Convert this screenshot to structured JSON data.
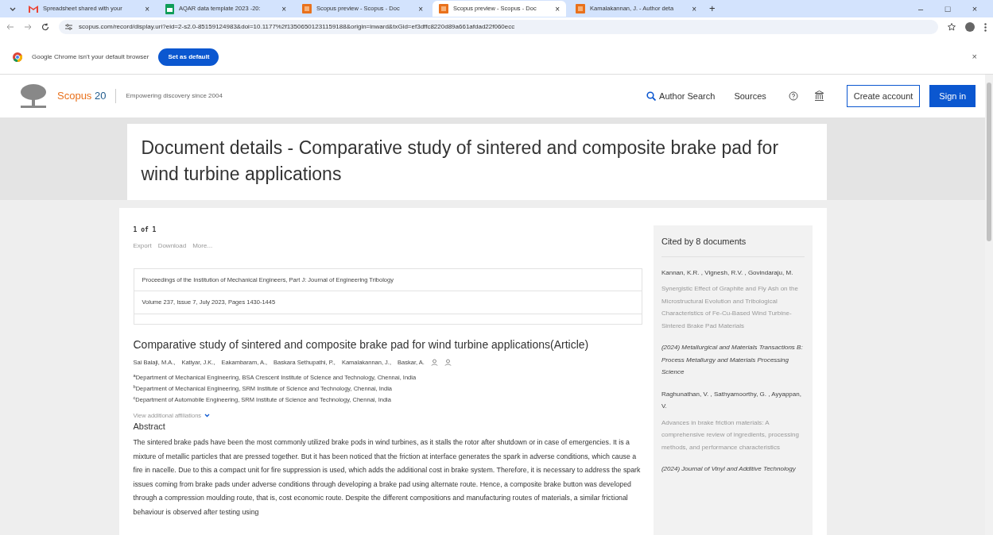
{
  "browser": {
    "tabs": [
      {
        "title": "Spreadsheet shared with your",
        "close": "×",
        "kind": "mail",
        "selected": false
      },
      {
        "title": "AQAR data template 2023 -20:",
        "close": "×",
        "kind": "sheet",
        "selected": false
      },
      {
        "title": "Scopus preview - Scopus - Doc",
        "close": "×",
        "kind": "scopus",
        "selected": false
      },
      {
        "title": "Scopus preview - Scopus - Doc",
        "close": "×",
        "kind": "scopus",
        "selected": true
      },
      {
        "title": "Kamalakannan, J. - Author deta",
        "close": "×",
        "kind": "scopus",
        "selected": false
      }
    ],
    "new_tab": "+",
    "window_controls": [
      "–",
      "□",
      "×"
    ],
    "url": "scopus.com/record/display.uri?eid=2-s2.0-85159124983&doi=10.1177%2f13506501231159188&origin=inward&txGid=ef3dffc8220d89a661afdad22f060ecc",
    "infobar": {
      "text": "Google Chrome isn't your default browser",
      "button": "Set as default",
      "close": "×"
    }
  },
  "header": {
    "brand": "Scopus",
    "anniversary": "20",
    "tagline": "Empowering discovery since 2004",
    "nav": [
      "Author Search",
      "Sources"
    ],
    "create_account": "Create account",
    "sign_in": "Sign in"
  },
  "page_title": "Document details - Comparative study of sintered and composite brake pad for wind turbine applications",
  "document": {
    "counter": "1 of 1",
    "actions": [
      "Export",
      "Download",
      "More..."
    ],
    "source": "Proceedings of the Institution of Mechanical Engineers, Part J: Journal of Engineering Tribology",
    "volume": "Volume 237, Issue 7, July 2023, Pages 1430-1445",
    "title": "Comparative study of sintered and composite brake pad for wind turbine applications(Article)",
    "authors": [
      "Sai Balaji, M.A.,",
      "Katiyar, J.K.,",
      "Eakambaram, A.,",
      "Baskara Sethupathi, P.,",
      "Kamalakannan, J.,",
      "Baskar, A."
    ],
    "affiliations": [
      "$^{a}$Department of Mechanical Engineering, BSA Crescent Institute of Science and Technology, Chennai, India",
      "$^{b}$Department of Mechanical Engineering, SRM Institute of Science and Technology, Chennai, India",
      "$^{c}$Department of Automobile Engineering, SRM Institute of Science and Technology, Chennai, India"
    ],
    "more_affiliations": "View additional affiliations",
    "abstract_heading": "Abstract",
    "abstract": "The sintered brake pads have been the most commonly utilized brake pods in wind turbines, as it stalls the rotor after shutdown or in case of emergencies. It is a mixture of metallic particles that are pressed together. But it has been noticed that the friction at interface generates the spark in adverse conditions, which cause a fire in nacelle. Due to this a compact unit for fire suppression is used, which adds the additional cost in brake system. Therefore, it is necessary to address the spark issues coming from brake pads under adverse conditions through developing a brake pad using alternate route. Hence, a composite brake button was developed through a compression moulding route, that is, cost economic route. Despite the different compositions and manufacturing routes of materials, a similar frictional behaviour is observed after testing using"
  },
  "cited_by": {
    "heading": "Cited by 8 documents",
    "items": [
      {
        "authors": "Kannan, K.R. , Vignesh, R.V. , Govindaraju, M.",
        "title": "Synergistic Effect of Graphite and Fly Ash on the Microstructural Evolution and Tribological Characteristics of Fe-Cu-Based Wind Turbine-Sintered Brake Pad Materials",
        "source": "(2024) Metallurgical and Materials Transactions B: Process Metallurgy and Materials Processing Science"
      },
      {
        "authors": "Raghunathan, V. , Sathyamoorthy, G. , Ayyappan, V.",
        "title": "Advances in brake friction materials: A comprehensive review of ingredients, processing methods, and performance characteristics",
        "source": "(2024) Journal of Vinyl and Additive Technology"
      }
    ]
  }
}
